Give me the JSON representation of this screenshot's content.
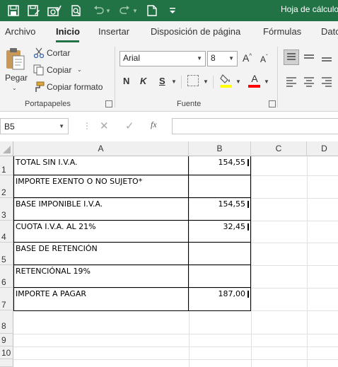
{
  "titlebar": {
    "title": "Hoja de cálculo",
    "icons": [
      "save-icon",
      "save-as-icon",
      "camera-save-icon",
      "print-preview-icon",
      "undo-icon",
      "redo-icon",
      "new-file-icon",
      "customize-toolbar-icon"
    ]
  },
  "ribbon": {
    "tabs": [
      {
        "label": "Archivo"
      },
      {
        "label": "Inicio"
      },
      {
        "label": "Insertar"
      },
      {
        "label": "Disposición de página"
      },
      {
        "label": "Fórmulas"
      },
      {
        "label": "Datos"
      }
    ],
    "active_tab": "Inicio",
    "clipboard": {
      "paste_label": "Pegar",
      "cut_label": "Cortar",
      "copy_label": "Copiar",
      "format_painter_label": "Copiar formato",
      "group_label": "Portapapeles"
    },
    "font": {
      "font_name": "Arial",
      "font_size": "8",
      "bold_label": "N",
      "italic_label": "K",
      "underline_label": "S",
      "group_label": "Fuente",
      "fill_color": "#ffff00",
      "font_color": "#ff0000"
    }
  },
  "formula_bar": {
    "name_box": "B5",
    "fx_label": "fx",
    "formula": ""
  },
  "grid": {
    "columns": [
      "A",
      "B",
      "C",
      "D"
    ],
    "rows": [
      "1",
      "2",
      "3",
      "4",
      "5",
      "6",
      "7",
      "8",
      "9",
      "10"
    ],
    "cells": {
      "A1": "TOTAL SIN I.V.A.",
      "B1": "154,55",
      "A2": "IMPORTE EXENTO O NO SUJETO*",
      "A3": "BASE IMPONIBLE I.V.A.",
      "B3": "154,55",
      "A4": "CUOTA I.V.A. AL 21%",
      "B4": "32,45",
      "A5": "BASE DE RETENCIÓN",
      "A6": "RETENCIÓNAL 19%",
      "A7": "IMPORTE A PAGAR",
      "B7": "187,00"
    }
  }
}
